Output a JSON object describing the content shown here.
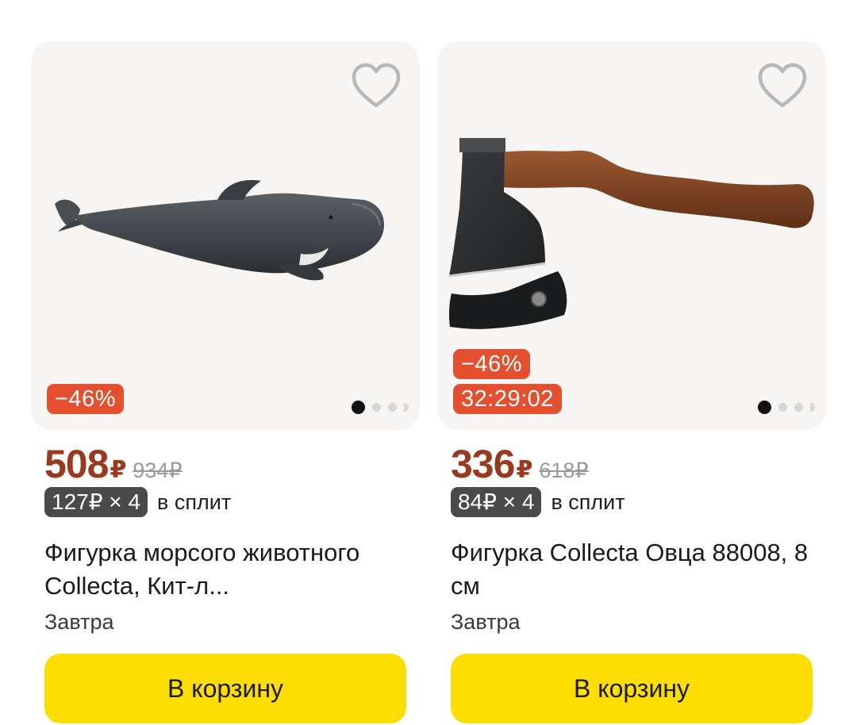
{
  "products": [
    {
      "image_icon": "pilot-whale-figurine",
      "discount_badge": "−46%",
      "price": "508",
      "currency": "₽",
      "old_price": "934₽",
      "split_payment": "127₽ × 4",
      "split_label": "в сплит",
      "title": "Фигурка морсого животного Collecta, Кит-л...",
      "delivery": "Завтра",
      "cart_button": "В корзину"
    },
    {
      "image_icon": "axe-with-sheath",
      "discount_badge": "−46%",
      "timer_badge": "32:29:02",
      "price": "336",
      "currency": "₽",
      "old_price": "618₽",
      "split_payment": "84₽ × 4",
      "split_label": "в сплит",
      "title": "Фигурка Collecta Овца 88008, 8 см",
      "delivery": "Завтра",
      "cart_button": "В корзину"
    }
  ],
  "colors": {
    "brand_yellow": "#fede00",
    "discount_red": "#e4502f",
    "price_brown": "#993a1e",
    "split_pill": "#4a4a4a"
  }
}
